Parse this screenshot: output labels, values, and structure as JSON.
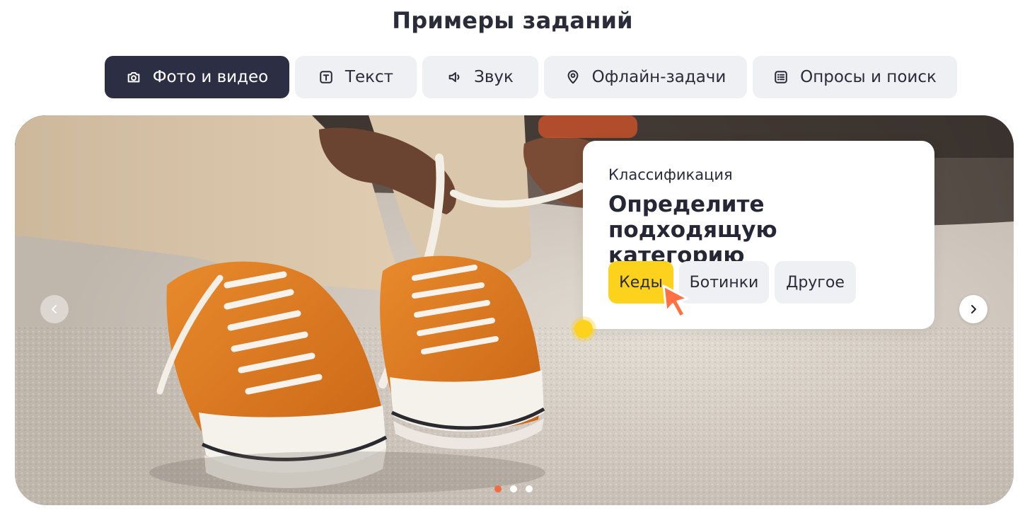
{
  "page": {
    "title": "Примеры заданий"
  },
  "tabs": [
    {
      "label": "Фото и видео",
      "icon": "camera-icon",
      "active": true
    },
    {
      "label": "Текст",
      "icon": "text-icon",
      "active": false
    },
    {
      "label": "Звук",
      "icon": "speaker-icon",
      "active": false
    },
    {
      "label": "Офлайн-задачи",
      "icon": "location-pin-icon",
      "active": false
    },
    {
      "label": "Опросы и поиск",
      "icon": "list-icon",
      "active": false
    }
  ],
  "carousel": {
    "image": "photo-sneakers-lacing",
    "prev_icon": "chevron-left-icon",
    "next_icon": "chevron-right-icon",
    "slides_total": 3,
    "active_slide": 1
  },
  "task_card": {
    "category": "Классификация",
    "question": "Определите подходящую категорию",
    "options": [
      {
        "label": "Кеды",
        "selected": true
      },
      {
        "label": "Ботинки",
        "selected": false
      },
      {
        "label": "Другое",
        "selected": false
      }
    ]
  },
  "colors": {
    "tab_active_bg": "#2c2e44",
    "tab_bg": "#eff0f4",
    "accent_yellow": "#fcd21d",
    "dot_active": "#f36b3f",
    "cursor": "#ff7043"
  }
}
